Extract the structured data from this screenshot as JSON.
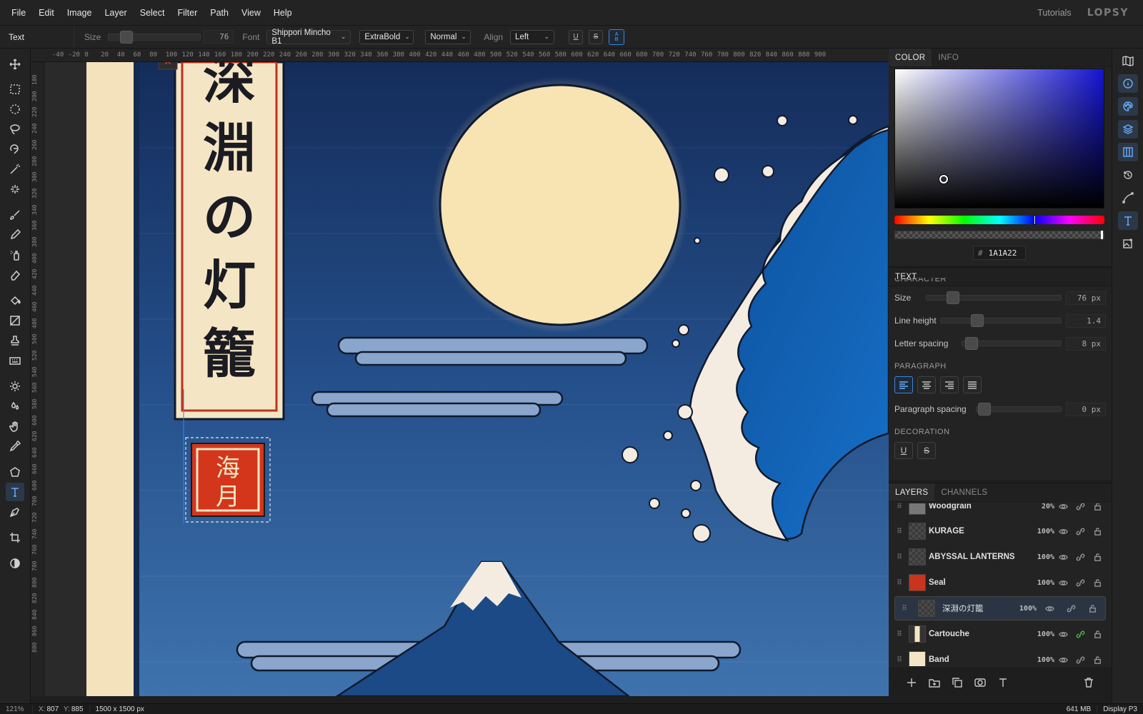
{
  "menu": {
    "items": [
      "File",
      "Edit",
      "Image",
      "Layer",
      "Select",
      "Filter",
      "Path",
      "View",
      "Help"
    ],
    "tutorials": "Tutorials",
    "logo": "LOPSY"
  },
  "options": {
    "tool": "Text",
    "size_label": "Size",
    "size_value": "76",
    "font_label": "Font",
    "font": "Shippori Mincho B1",
    "weight": "ExtraBold",
    "style": "Normal",
    "align_label": "Align",
    "align": "Left",
    "underline": "U",
    "strike": "S",
    "ab_top": "A",
    "ab_bottom": "B"
  },
  "ruler_h": [
    "-40",
    "-20",
    "0",
    "20",
    "40",
    "60",
    "80",
    "100",
    "120",
    "140",
    "160",
    "180",
    "200",
    "220",
    "240",
    "260",
    "280",
    "300",
    "320",
    "340",
    "360",
    "380",
    "400",
    "420",
    "440",
    "460",
    "480",
    "500",
    "520",
    "540",
    "560",
    "580",
    "600",
    "620",
    "640",
    "660",
    "680",
    "700",
    "720",
    "740",
    "760",
    "780",
    "800",
    "820",
    "840",
    "860",
    "880",
    "900"
  ],
  "ruler_v": [
    "180",
    "200",
    "220",
    "240",
    "260",
    "280",
    "300",
    "320",
    "340",
    "360",
    "380",
    "400",
    "420",
    "440",
    "460",
    "480",
    "500",
    "520",
    "540",
    "560",
    "580",
    "600",
    "620",
    "640",
    "660",
    "680",
    "700",
    "720",
    "740",
    "760",
    "780",
    "800",
    "820",
    "840",
    "860",
    "880"
  ],
  "artwork": {
    "title_chars": [
      "深",
      "淵",
      "の",
      "灯",
      "籠"
    ],
    "seal_chars": [
      "海",
      "月"
    ]
  },
  "color_panel": {
    "tab_color": "COLOR",
    "tab_info": "INFO",
    "hex_prefix": "#",
    "hex": "1A1A22"
  },
  "text_panel": {
    "title": "TEXT",
    "character_header": "CHARACTER",
    "size_label": "Size",
    "size_value": "76 px",
    "line_height_label": "Line height",
    "line_height_value": "1.4",
    "letter_spacing_label": "Letter spacing",
    "letter_spacing_value": "8 px",
    "paragraph_header": "PARAGRAPH",
    "paragraph_spacing_label": "Paragraph spacing",
    "paragraph_spacing_value": "0 px",
    "decoration_header": "DECORATION",
    "underline": "U",
    "strike": "S"
  },
  "layers_panel": {
    "tab_layers": "LAYERS",
    "tab_channels": "CHANNELS",
    "layers": [
      {
        "name": "Woodgrain",
        "opacity": "20%"
      },
      {
        "name": "KURAGE",
        "opacity": "100%"
      },
      {
        "name": "ABYSSAL LANTERNS",
        "opacity": "100%"
      },
      {
        "name": "Seal",
        "opacity": "100%"
      },
      {
        "name": "深淵の灯籠",
        "opacity": "100%"
      },
      {
        "name": "Cartouche",
        "opacity": "100%"
      },
      {
        "name": "Band",
        "opacity": "100%"
      }
    ]
  },
  "status": {
    "zoom": "121%",
    "x_label": "X:",
    "x": "807",
    "y_label": "Y:",
    "y": "885",
    "doc_size": "1500 x 1500 px",
    "memory": "641 MB",
    "profile": "Display P3"
  }
}
